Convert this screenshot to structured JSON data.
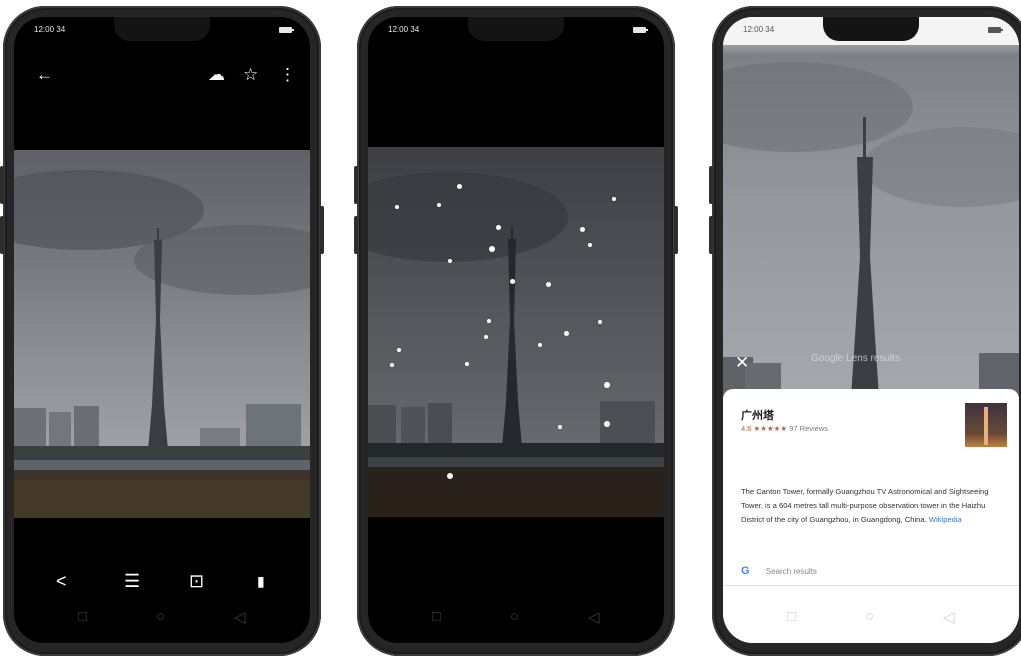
{
  "status_bar": {
    "time": "12:00 34"
  },
  "left_phone": {
    "icons": [
      "back-arrow-icon",
      "cloud-upload-icon",
      "star-outline-icon",
      "more-vert-icon"
    ],
    "bottom_icons": [
      "share-icon",
      "edit-sliders-icon",
      "lens-icon",
      "delete-icon"
    ],
    "glyphs": {
      "back": "←",
      "cloud": "☁",
      "star": "☆",
      "more": "⋮",
      "share": "<",
      "edit": "☰",
      "lens": "⊡",
      "delete": "▮"
    }
  },
  "nav_glyphs": {
    "recent": "□",
    "home": "○",
    "back": "◁"
  },
  "lens_result": {
    "close_glyph": "✕",
    "sheet_label": "Google Lens results",
    "place_name": "广州塔",
    "rating": "4.6 ★★★★★",
    "reviews": "97 Reviews",
    "description": "The Canton Tower, formally Guangzhou TV Astronomical and Sightseeing Tower, is a 604 metres tall multi-purpose observation tower in the Haizhu District of the city of Guangzhou, in Guangdong, China.",
    "source_link": "Wikipedia",
    "google_glyph": "G",
    "search_label": "Search results"
  },
  "colors": {
    "accent_link": "#3a78d4",
    "rating": "#b0693a",
    "phone_body": "#262626"
  }
}
